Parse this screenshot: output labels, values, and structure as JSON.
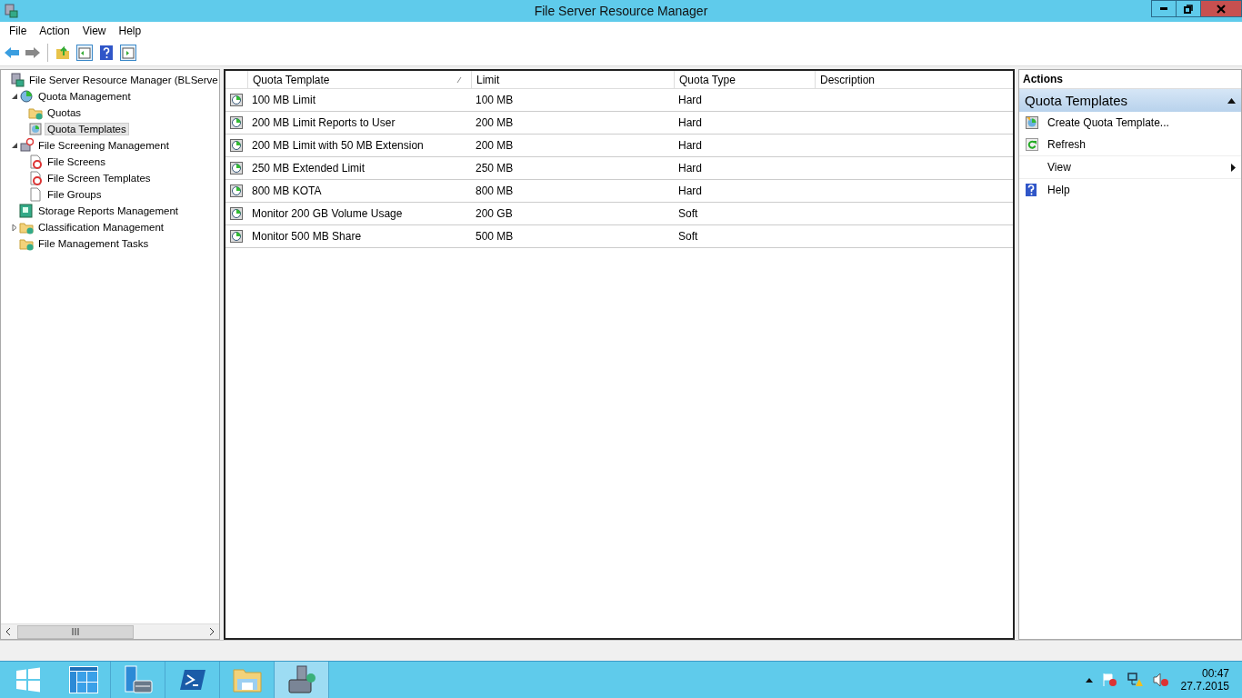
{
  "window": {
    "title": "File Server Resource Manager"
  },
  "menu": [
    "File",
    "Action",
    "View",
    "Help"
  ],
  "tree": [
    {
      "label": "File Server Resource Manager (BLServe",
      "kind": "server",
      "selected": false,
      "children": [
        {
          "label": "Quota Management",
          "kind": "quota",
          "expanded": true,
          "selected": false,
          "children": [
            {
              "label": "Quotas",
              "kind": "folder",
              "selected": false
            },
            {
              "label": "Quota Templates",
              "kind": "template",
              "selected": true
            }
          ]
        },
        {
          "label": "File Screening Management",
          "kind": "screen",
          "expanded": true,
          "selected": false,
          "children": [
            {
              "label": "File Screens",
              "kind": "block",
              "selected": false
            },
            {
              "label": "File Screen Templates",
              "kind": "block",
              "selected": false
            },
            {
              "label": "File Groups",
              "kind": "page",
              "selected": false
            }
          ]
        },
        {
          "label": "Storage Reports Management",
          "kind": "report",
          "selected": false
        },
        {
          "label": "Classification Management",
          "kind": "folder",
          "expanded": false,
          "selected": false
        },
        {
          "label": "File Management Tasks",
          "kind": "folder",
          "selected": false
        }
      ]
    }
  ],
  "table": {
    "columns": [
      "Quota Template",
      "Limit",
      "Quota Type",
      "Description"
    ],
    "rows": [
      {
        "name": "100 MB Limit",
        "limit": "100 MB",
        "type": "Hard"
      },
      {
        "name": "200 MB Limit Reports to User",
        "limit": "200 MB",
        "type": "Hard"
      },
      {
        "name": "200 MB Limit with 50 MB Extension",
        "limit": "200 MB",
        "type": "Hard"
      },
      {
        "name": "250 MB Extended Limit",
        "limit": "250 MB",
        "type": "Hard"
      },
      {
        "name": "800 MB KOTA",
        "limit": "800 MB",
        "type": "Hard"
      },
      {
        "name": "Monitor 200 GB Volume Usage",
        "limit": "200 GB",
        "type": "Soft"
      },
      {
        "name": "Monitor 500 MB Share",
        "limit": "500 MB",
        "type": "Soft"
      }
    ]
  },
  "actions": {
    "title": "Actions",
    "section": "Quota Templates",
    "expanded": true,
    "items": [
      {
        "label": "Create Quota Template...",
        "kind": "create"
      },
      {
        "label": "Refresh",
        "kind": "refresh"
      },
      {
        "label": "View",
        "kind": "submenu"
      },
      {
        "label": "Help",
        "kind": "help"
      }
    ]
  },
  "taskbar": {
    "apps": [
      {
        "kind": "tiles",
        "selected": false
      },
      {
        "kind": "server",
        "selected": false
      },
      {
        "kind": "shell",
        "selected": false
      },
      {
        "kind": "folder",
        "selected": false
      },
      {
        "kind": "toolbox",
        "selected": true
      }
    ],
    "time": "00:47",
    "date": "27.7.2015"
  }
}
